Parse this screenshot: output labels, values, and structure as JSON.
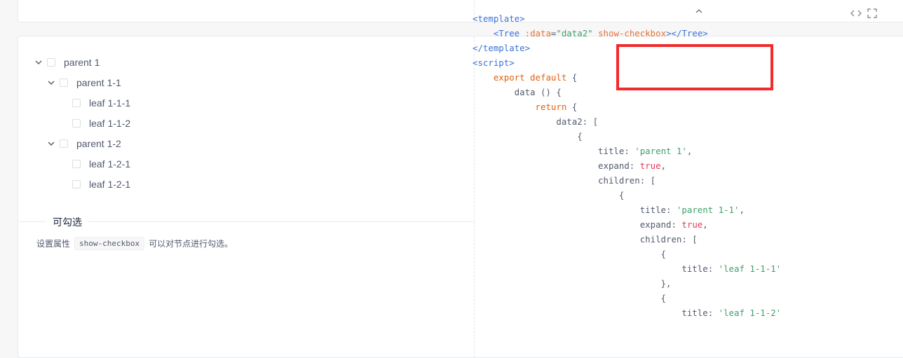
{
  "top_card": {
    "collapse_icon": "chevron-up-icon"
  },
  "tree": [
    {
      "title": "parent 1",
      "level": 0,
      "expanded": true
    },
    {
      "title": "parent 1-1",
      "level": 1,
      "expanded": true
    },
    {
      "title": "leaf 1-1-1",
      "level": 2,
      "leaf": true
    },
    {
      "title": "leaf 1-1-2",
      "level": 2,
      "leaf": true
    },
    {
      "title": "parent 1-2",
      "level": 1,
      "expanded": true
    },
    {
      "title": "leaf 1-2-1",
      "level": 2,
      "leaf": true
    },
    {
      "title": "leaf 1-2-1",
      "level": 2,
      "leaf": true
    }
  ],
  "section": {
    "title": "可勾选",
    "desc_prefix": "设置属性",
    "desc_code": "show-checkbox",
    "desc_suffix": "可以对节点进行勾选。"
  },
  "code_tools": {
    "code_icon": "code-icon",
    "fullscreen_icon": "fullscreen-icon"
  },
  "code_lines": [
    [
      [
        "tag",
        "<template>"
      ]
    ],
    [
      [
        "plain",
        "    "
      ],
      [
        "tag",
        "<Tree "
      ],
      [
        "attr",
        ":data"
      ],
      [
        "plain",
        "="
      ],
      [
        "str",
        "\"data2\""
      ],
      [
        "plain",
        " "
      ],
      [
        "attr",
        "show-checkbox"
      ],
      [
        "tag",
        "></Tree>"
      ]
    ],
    [
      [
        "tag",
        "</template>"
      ]
    ],
    [
      [
        "tag",
        "<script>"
      ]
    ],
    [
      [
        "plain",
        "    "
      ],
      [
        "kw",
        "export default"
      ],
      [
        "plain",
        " {"
      ]
    ],
    [
      [
        "plain",
        "        data () {"
      ]
    ],
    [
      [
        "plain",
        "            "
      ],
      [
        "kw",
        "return"
      ],
      [
        "plain",
        " {"
      ]
    ],
    [
      [
        "plain",
        "                data2: ["
      ]
    ],
    [
      [
        "plain",
        "                    {"
      ]
    ],
    [
      [
        "plain",
        "                        title: "
      ],
      [
        "str",
        "'parent 1'"
      ],
      [
        "plain",
        ","
      ]
    ],
    [
      [
        "plain",
        "                        expand: "
      ],
      [
        "bool",
        "true"
      ],
      [
        "plain",
        ","
      ]
    ],
    [
      [
        "plain",
        "                        children: ["
      ]
    ],
    [
      [
        "plain",
        "                            {"
      ]
    ],
    [
      [
        "plain",
        "                                title: "
      ],
      [
        "str",
        "'parent 1-1'"
      ],
      [
        "plain",
        ","
      ]
    ],
    [
      [
        "plain",
        "                                expand: "
      ],
      [
        "bool",
        "true"
      ],
      [
        "plain",
        ","
      ]
    ],
    [
      [
        "plain",
        "                                children: ["
      ]
    ],
    [
      [
        "plain",
        "                                    {"
      ]
    ],
    [
      [
        "plain",
        "                                        title: "
      ],
      [
        "str",
        "'leaf 1-1-1'"
      ]
    ],
    [
      [
        "plain",
        "                                    },"
      ]
    ],
    [
      [
        "plain",
        "                                    {"
      ]
    ],
    [
      [
        "plain",
        "                                        title: "
      ],
      [
        "str",
        "'leaf 1-1-2'"
      ]
    ]
  ]
}
